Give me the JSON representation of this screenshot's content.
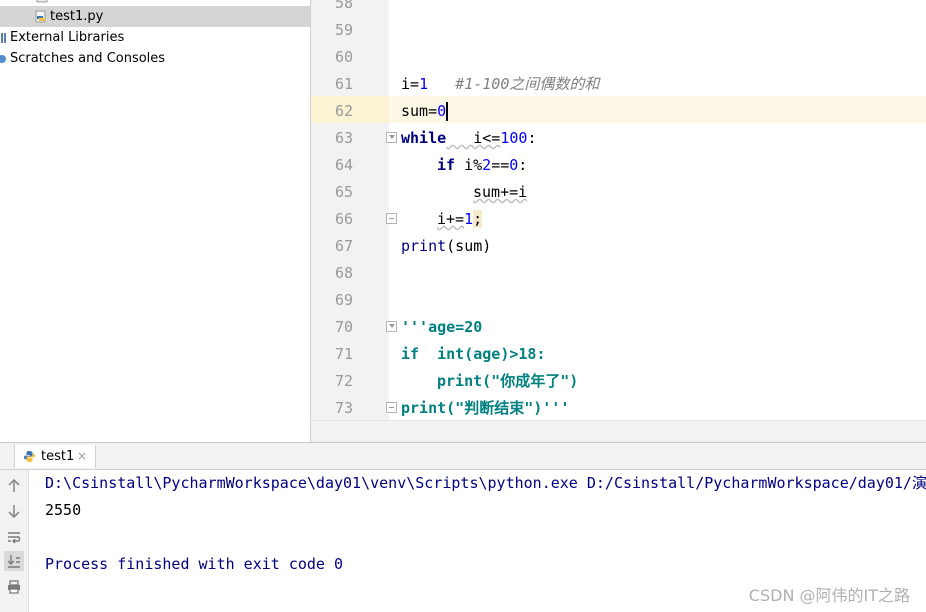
{
  "project_tree": {
    "items": [
      {
        "label": "test1.py",
        "icon": "python-file-icon"
      },
      {
        "label": "External Libraries",
        "icon": "library-icon"
      },
      {
        "label": "Scratches and Consoles",
        "icon": "scratches-icon"
      }
    ]
  },
  "editor": {
    "line_numbers": [
      "58",
      "59",
      "60",
      "61",
      "62",
      "63",
      "64",
      "65",
      "66",
      "67",
      "68",
      "69",
      "70",
      "71",
      "72",
      "73"
    ],
    "code": {
      "l60_comment": "#1-100之间偶数的和",
      "l61_a": "i=",
      "l61_b": "1",
      "l62_a": "sum=",
      "l62_b": "0",
      "l63_kw": "while",
      "l63_a": "   i<=",
      "l63_b": "100",
      "l63_c": ":",
      "l64_kw": "if",
      "l64_a": " i%",
      "l64_b": "2",
      "l64_c": "==",
      "l64_d": "0",
      "l64_e": ":",
      "l65_a": "sum+=i",
      "l66_a": "i+=",
      "l66_b": "1",
      "l66_c": ";",
      "l67_fn": "print",
      "l67_a": "(sum)",
      "l70": "'''age=20",
      "l71": "if  int(age)>18:",
      "l72": "print(\"你成年了\")",
      "l73": "print(\"判断结束\")'''"
    }
  },
  "run_panel": {
    "tab_label": "test1",
    "tab_close": "×",
    "console": {
      "command": "D:\\Csinstall\\PycharmWorkspace\\day01\\venv\\Scripts\\python.exe D:/Csinstall/PycharmWorkspace/day01/演",
      "output": "2550",
      "process": "Process finished with exit code 0"
    }
  },
  "watermark": "CSDN @阿伟的IT之路",
  "colors": {
    "keyword": "#000080",
    "number": "#0000ff",
    "comment": "#808080",
    "docstring": "#008080",
    "caret_line": "#fdf9e6",
    "selection": "#d5d5d5"
  }
}
